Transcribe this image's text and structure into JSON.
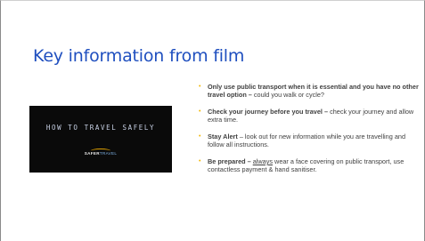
{
  "slide": {
    "title": "Key information from film",
    "video": {
      "title_text": "HOW TO TRAVEL SAFELY",
      "logo_part1": "SAFER",
      "logo_part2": "TRAVEL"
    },
    "bullet_marker": "•",
    "bullets": [
      {
        "bold": "Only use public transport when it is essential and you have no other travel option –",
        "text": " could you walk or cycle?"
      },
      {
        "bold": "Check your journey before you travel –",
        "text": " check your journey and allow extra time."
      },
      {
        "bold": "Stay Alert",
        "text": " – look out for new information while you are travelling and follow all instructions."
      },
      {
        "bold": "Be prepared –",
        "underline": "always",
        "text": " wear a face covering on public transport, use contactless  payment & hand sanitiser."
      }
    ],
    "colors": {
      "title": "#1f4fbf",
      "bullet": "#f2b705",
      "video_bg": "#0a0a0a"
    }
  }
}
